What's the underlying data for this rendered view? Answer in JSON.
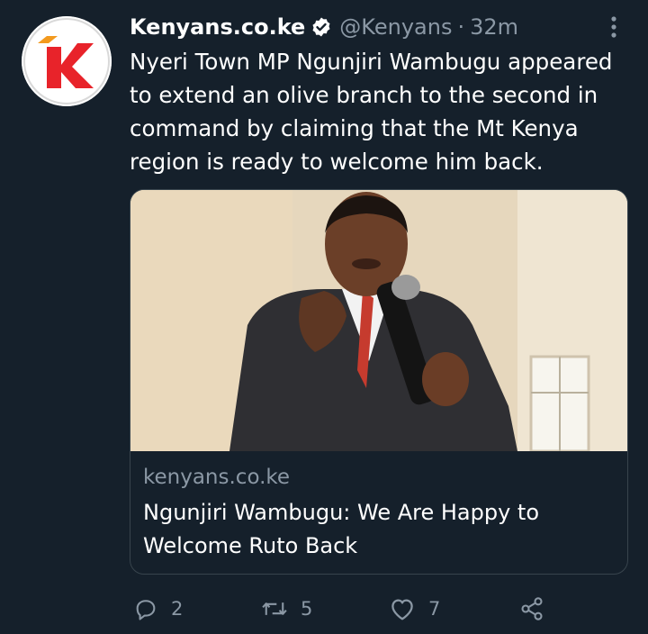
{
  "author": {
    "name": "Kenyans.co.ke",
    "handle": "@Kenyans",
    "separator": "·",
    "time": "32m"
  },
  "tweet": {
    "text": "Nyeri Town MP Ngunjiri Wambugu appeared to extend an olive branch to the second in command by claiming that the Mt Kenya region is ready to welcome him back."
  },
  "card": {
    "domain": "kenyans.co.ke",
    "title": "Ngunjiri Wambugu: We Are Happy to Welcome Ruto Back"
  },
  "actions": {
    "replies": "2",
    "retweets": "5",
    "likes": "7"
  },
  "icons": {
    "verified": "verified-badge-icon",
    "more": "more-vertical-icon",
    "reply": "reply-icon",
    "retweet": "retweet-icon",
    "like": "heart-icon",
    "share": "share-icon"
  },
  "colors": {
    "background": "#15202b",
    "secondary_text": "#8b98a5",
    "border": "#38444d",
    "brand_red": "#e8232a",
    "brand_orange": "#f39a1e"
  }
}
